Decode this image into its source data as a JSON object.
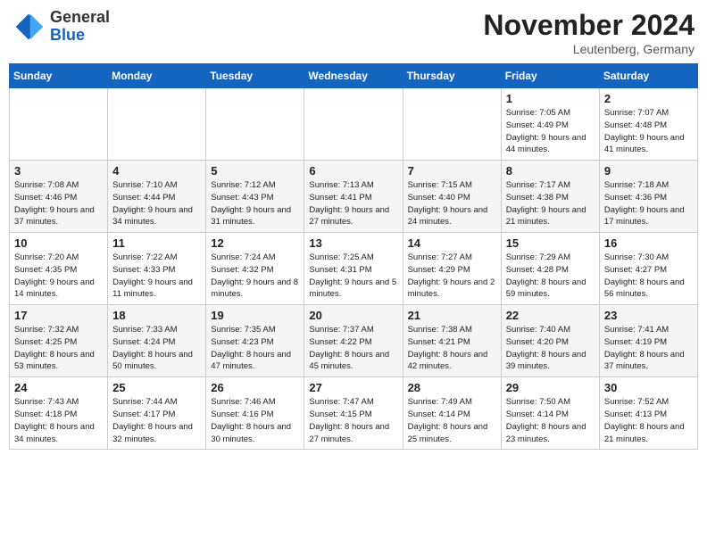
{
  "header": {
    "logo_line1": "General",
    "logo_line2": "Blue",
    "month_year": "November 2024",
    "location": "Leutenberg, Germany"
  },
  "weekdays": [
    "Sunday",
    "Monday",
    "Tuesday",
    "Wednesday",
    "Thursday",
    "Friday",
    "Saturday"
  ],
  "weeks": [
    [
      {
        "day": "",
        "info": ""
      },
      {
        "day": "",
        "info": ""
      },
      {
        "day": "",
        "info": ""
      },
      {
        "day": "",
        "info": ""
      },
      {
        "day": "",
        "info": ""
      },
      {
        "day": "1",
        "info": "Sunrise: 7:05 AM\nSunset: 4:49 PM\nDaylight: 9 hours\nand 44 minutes."
      },
      {
        "day": "2",
        "info": "Sunrise: 7:07 AM\nSunset: 4:48 PM\nDaylight: 9 hours\nand 41 minutes."
      }
    ],
    [
      {
        "day": "3",
        "info": "Sunrise: 7:08 AM\nSunset: 4:46 PM\nDaylight: 9 hours\nand 37 minutes."
      },
      {
        "day": "4",
        "info": "Sunrise: 7:10 AM\nSunset: 4:44 PM\nDaylight: 9 hours\nand 34 minutes."
      },
      {
        "day": "5",
        "info": "Sunrise: 7:12 AM\nSunset: 4:43 PM\nDaylight: 9 hours\nand 31 minutes."
      },
      {
        "day": "6",
        "info": "Sunrise: 7:13 AM\nSunset: 4:41 PM\nDaylight: 9 hours\nand 27 minutes."
      },
      {
        "day": "7",
        "info": "Sunrise: 7:15 AM\nSunset: 4:40 PM\nDaylight: 9 hours\nand 24 minutes."
      },
      {
        "day": "8",
        "info": "Sunrise: 7:17 AM\nSunset: 4:38 PM\nDaylight: 9 hours\nand 21 minutes."
      },
      {
        "day": "9",
        "info": "Sunrise: 7:18 AM\nSunset: 4:36 PM\nDaylight: 9 hours\nand 17 minutes."
      }
    ],
    [
      {
        "day": "10",
        "info": "Sunrise: 7:20 AM\nSunset: 4:35 PM\nDaylight: 9 hours\nand 14 minutes."
      },
      {
        "day": "11",
        "info": "Sunrise: 7:22 AM\nSunset: 4:33 PM\nDaylight: 9 hours\nand 11 minutes."
      },
      {
        "day": "12",
        "info": "Sunrise: 7:24 AM\nSunset: 4:32 PM\nDaylight: 9 hours\nand 8 minutes."
      },
      {
        "day": "13",
        "info": "Sunrise: 7:25 AM\nSunset: 4:31 PM\nDaylight: 9 hours\nand 5 minutes."
      },
      {
        "day": "14",
        "info": "Sunrise: 7:27 AM\nSunset: 4:29 PM\nDaylight: 9 hours\nand 2 minutes."
      },
      {
        "day": "15",
        "info": "Sunrise: 7:29 AM\nSunset: 4:28 PM\nDaylight: 8 hours\nand 59 minutes."
      },
      {
        "day": "16",
        "info": "Sunrise: 7:30 AM\nSunset: 4:27 PM\nDaylight: 8 hours\nand 56 minutes."
      }
    ],
    [
      {
        "day": "17",
        "info": "Sunrise: 7:32 AM\nSunset: 4:25 PM\nDaylight: 8 hours\nand 53 minutes."
      },
      {
        "day": "18",
        "info": "Sunrise: 7:33 AM\nSunset: 4:24 PM\nDaylight: 8 hours\nand 50 minutes."
      },
      {
        "day": "19",
        "info": "Sunrise: 7:35 AM\nSunset: 4:23 PM\nDaylight: 8 hours\nand 47 minutes."
      },
      {
        "day": "20",
        "info": "Sunrise: 7:37 AM\nSunset: 4:22 PM\nDaylight: 8 hours\nand 45 minutes."
      },
      {
        "day": "21",
        "info": "Sunrise: 7:38 AM\nSunset: 4:21 PM\nDaylight: 8 hours\nand 42 minutes."
      },
      {
        "day": "22",
        "info": "Sunrise: 7:40 AM\nSunset: 4:20 PM\nDaylight: 8 hours\nand 39 minutes."
      },
      {
        "day": "23",
        "info": "Sunrise: 7:41 AM\nSunset: 4:19 PM\nDaylight: 8 hours\nand 37 minutes."
      }
    ],
    [
      {
        "day": "24",
        "info": "Sunrise: 7:43 AM\nSunset: 4:18 PM\nDaylight: 8 hours\nand 34 minutes."
      },
      {
        "day": "25",
        "info": "Sunrise: 7:44 AM\nSunset: 4:17 PM\nDaylight: 8 hours\nand 32 minutes."
      },
      {
        "day": "26",
        "info": "Sunrise: 7:46 AM\nSunset: 4:16 PM\nDaylight: 8 hours\nand 30 minutes."
      },
      {
        "day": "27",
        "info": "Sunrise: 7:47 AM\nSunset: 4:15 PM\nDaylight: 8 hours\nand 27 minutes."
      },
      {
        "day": "28",
        "info": "Sunrise: 7:49 AM\nSunset: 4:14 PM\nDaylight: 8 hours\nand 25 minutes."
      },
      {
        "day": "29",
        "info": "Sunrise: 7:50 AM\nSunset: 4:14 PM\nDaylight: 8 hours\nand 23 minutes."
      },
      {
        "day": "30",
        "info": "Sunrise: 7:52 AM\nSunset: 4:13 PM\nDaylight: 8 hours\nand 21 minutes."
      }
    ]
  ]
}
